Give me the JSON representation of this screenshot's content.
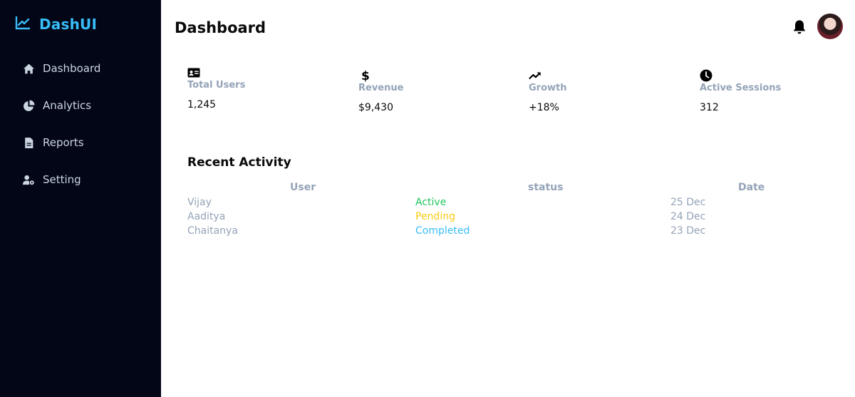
{
  "brand": {
    "name": "DashUI",
    "color": "#38bdf8",
    "icon": "chart-line-icon"
  },
  "sidebar": {
    "items": [
      {
        "label": "Dashboard",
        "icon": "home-icon"
      },
      {
        "label": "Analytics",
        "icon": "pie-chart-icon"
      },
      {
        "label": "Reports",
        "icon": "file-icon"
      },
      {
        "label": "Setting",
        "icon": "user-gear-icon"
      }
    ]
  },
  "header": {
    "title": "Dashboard",
    "bell_icon": "bell-icon",
    "avatar": "user-avatar"
  },
  "stats": [
    {
      "label": "Total Users",
      "value": "1,245",
      "icon": "id-card-icon"
    },
    {
      "label": "Revenue",
      "value": "$9,430",
      "icon": "dollar-icon"
    },
    {
      "label": "Growth",
      "value": "+18%",
      "icon": "trending-up-icon"
    },
    {
      "label": "Active Sessions",
      "value": "312",
      "icon": "clock-icon"
    }
  ],
  "activity": {
    "title": "Recent Activity",
    "columns": [
      "User",
      "status",
      "Date"
    ],
    "rows": [
      {
        "user": "Vijay",
        "status": "Active",
        "status_color": "#22c55e",
        "date": "25 Dec"
      },
      {
        "user": "Aaditya",
        "status": "Pending",
        "status_color": "#facc15",
        "date": "24 Dec"
      },
      {
        "user": "Chaitanya",
        "status": "Completed",
        "status_color": "#38bdf8",
        "date": "23 Dec"
      }
    ]
  },
  "colors": {
    "sidebar_bg": "#020617",
    "muted": "#94a3b8",
    "nav_text": "#cbd5e1"
  }
}
